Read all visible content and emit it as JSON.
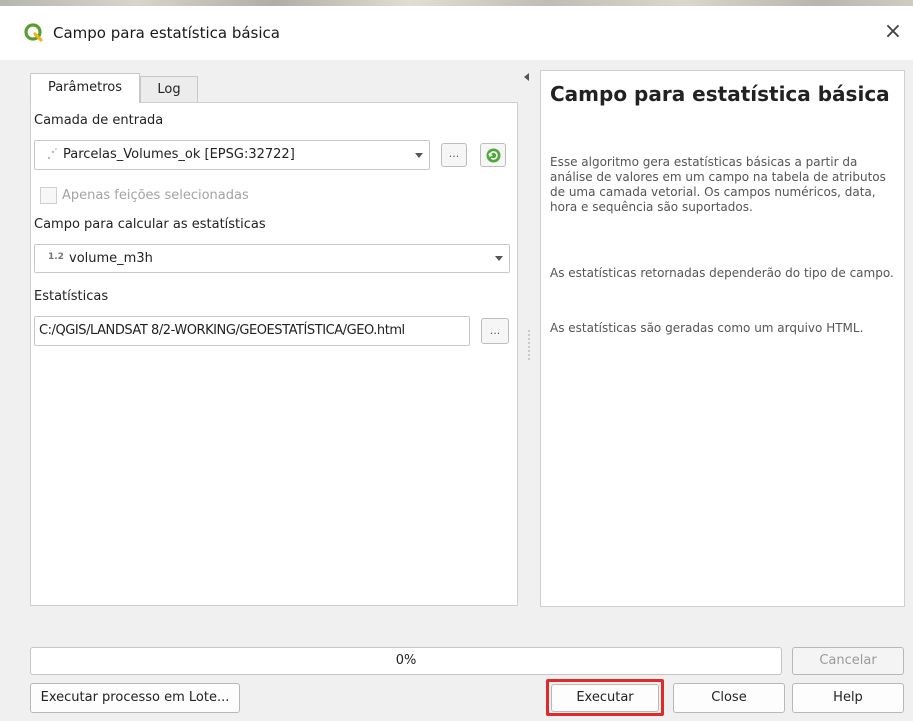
{
  "window": {
    "title": "Campo para estatística básica",
    "close_glyph": "×",
    "app_icon": "qgis-logo-icon"
  },
  "tabs": [
    {
      "label": "Parâmetros",
      "active": true
    },
    {
      "label": "Log",
      "active": false
    }
  ],
  "params": {
    "input_layer_label": "Camada de entrada",
    "input_layer_value": "Parcelas_Volumes_ok [EPSG:32722]",
    "input_layer_icon": "point-layer-icon",
    "browse_label": "...",
    "iterate_icon": "iterate-icon",
    "selected_only_label": "Apenas feições selecionadas",
    "selected_only_checked": false,
    "field_label": "Campo para calcular as estatísticas",
    "field_type_badge": "1.2",
    "field_value": "volume_m3h",
    "stats_label": "Estatísticas",
    "stats_value": "C:/QGIS/LANDSAT 8/2-WORKING/GEOESTATÍSTICA/GEO.html"
  },
  "help": {
    "title": "Campo para estatística básica",
    "paragraphs": [
      "Esse algoritmo gera estatísticas básicas a partir da análise de valores em um campo na tabela de atributos de uma camada vetorial. Os campos numéricos, data, hora e sequência são suportados.",
      "As estatísticas retornadas dependerão do tipo de campo.",
      "As estatísticas são geradas como um arquivo HTML."
    ]
  },
  "progress": {
    "value": 0,
    "text": "0%"
  },
  "buttons": {
    "cancel": "Cancelar",
    "batch": "Executar processo em Lote...",
    "run": "Executar",
    "close": "Close",
    "help": "Help"
  },
  "colors": {
    "highlight": "#e02a2a",
    "qgis_green": "#5a9e2f",
    "progress_fill": "#3b8bd0"
  }
}
